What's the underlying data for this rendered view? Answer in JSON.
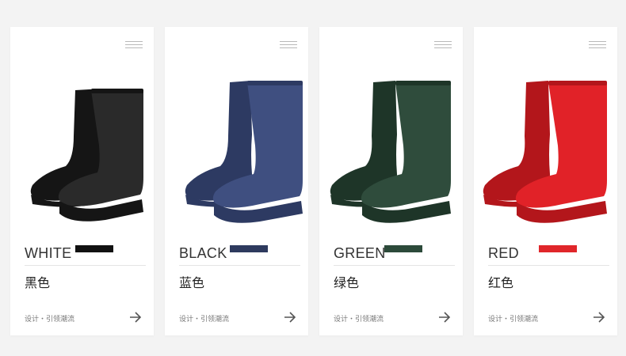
{
  "cards": [
    {
      "color_en": "WHITE",
      "color_cn": "黑色",
      "swatch": "#111111",
      "boot_color": "#2a2a2a",
      "boot_shade": "#151515",
      "tagline": "设计・引领潮流"
    },
    {
      "color_en": "BLACK",
      "color_cn": "蓝色",
      "swatch": "#2e3a5e",
      "boot_color": "#3f4f80",
      "boot_shade": "#2d3a62",
      "tagline": "设计・引领潮流"
    },
    {
      "color_en": "GREEN",
      "color_cn": "绿色",
      "swatch": "#2c4a3a",
      "boot_color": "#2f4c3c",
      "boot_shade": "#1e3528",
      "tagline": "设计・引领潮流"
    },
    {
      "color_en": "RED",
      "color_cn": "红色",
      "swatch": "#e0262a",
      "boot_color": "#e12228",
      "boot_shade": "#b3161b",
      "tagline": "设计・引领潮流"
    }
  ],
  "icons": {
    "menu": "menu-icon",
    "arrow": "arrow-right-icon"
  }
}
